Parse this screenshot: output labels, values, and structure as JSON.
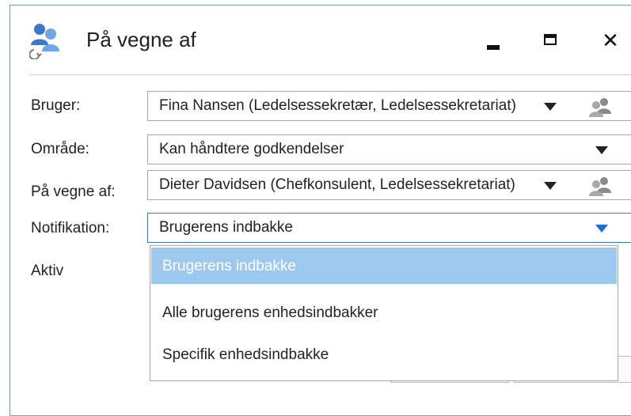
{
  "window": {
    "title": "På vegne af"
  },
  "fields": {
    "bruger": {
      "label": "Bruger:",
      "value": "Fina Nansen (Ledelsessekretær, Ledelsessekretariat)"
    },
    "omraade": {
      "label": "Område:",
      "value": "Kan håndtere godkendelser"
    },
    "paa_vegne_af": {
      "label": "På vegne af:",
      "value": "Dieter Davidsen (Chefkonsulent, Ledelsessekretariat)"
    },
    "notifikation": {
      "label": "Notifikation:",
      "value": "Brugerens indbakke"
    },
    "aktiv": {
      "label": "Aktiv"
    }
  },
  "dropdown": {
    "options": [
      "Brugerens indbakke",
      "Alle brugerens enhedsindbakker",
      "Specifik enhedsindbakke"
    ],
    "selected_index": 0
  },
  "colors": {
    "accent": "#1e6fd1",
    "selection": "#9ec9ef",
    "border": "#7a9cc4"
  }
}
